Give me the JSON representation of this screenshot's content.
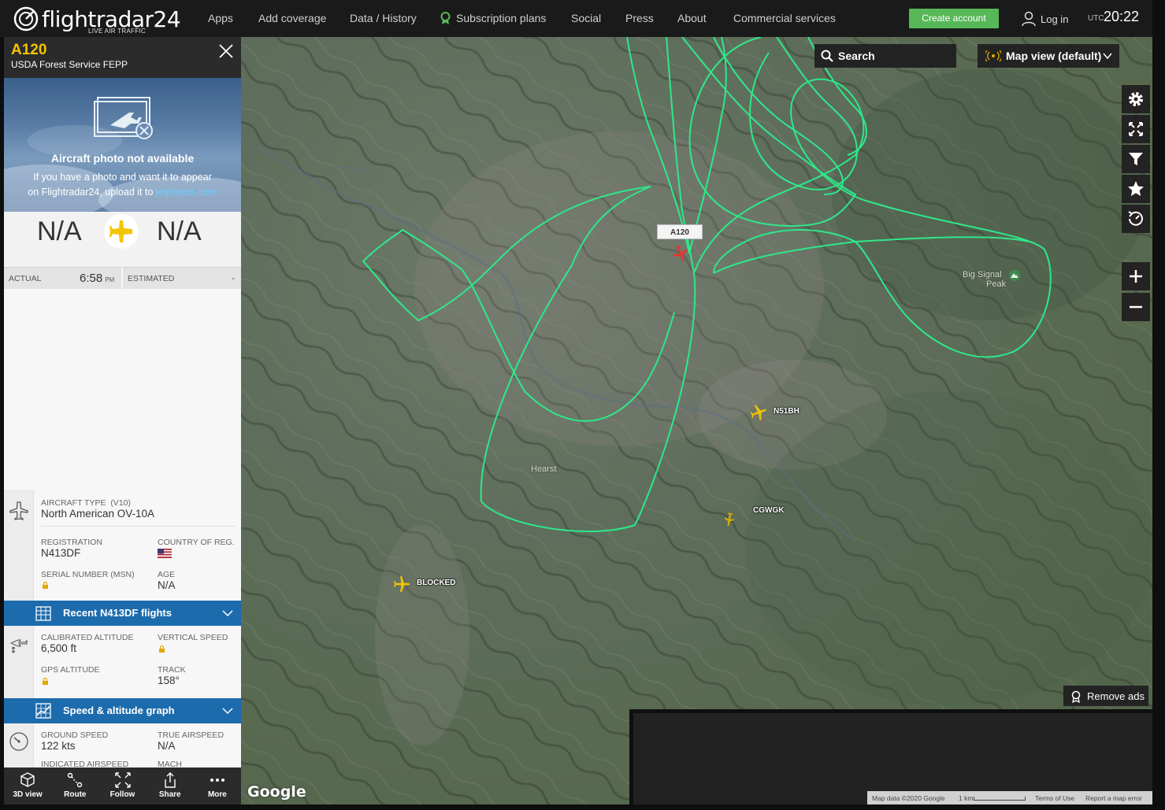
{
  "topbar": {
    "brand": "flightradar24",
    "tagline": "LIVE AIR TRAFFIC",
    "nav": [
      "Apps",
      "Add coverage",
      "Data / History",
      "Subscription plans",
      "Social",
      "Press",
      "About",
      "Commercial services"
    ],
    "create_account": "Create account",
    "login": "Log in",
    "utc_label": "UTC",
    "utc_time": "20:22"
  },
  "flight": {
    "callsign": "A120",
    "operator": "USDA Forest Service FEPP",
    "photo_title": "Aircraft photo not available",
    "photo_line1": "If you have a photo and want it to appear",
    "photo_line2": "on Flightradar24, upload it to",
    "photo_link": "jetphotos.com",
    "departure": "N/A",
    "arrival": "N/A",
    "actual_label": "ACTUAL",
    "actual_time": "6:58",
    "actual_ampm": "PM",
    "estimated_label": "ESTIMATED",
    "estimated_value": "-"
  },
  "aircraft": {
    "type_label": "AIRCRAFT TYPE",
    "type_code": "(V10)",
    "type_value": "North American OV-10A",
    "registration_label": "REGISTRATION",
    "registration_value": "N413DF",
    "country_label": "COUNTRY OF REG.",
    "serial_label": "SERIAL NUMBER (MSN)",
    "age_label": "AGE",
    "age_value": "N/A"
  },
  "recent_flights_label": "Recent N413DF flights",
  "altitude": {
    "cal_alt_label": "CALIBRATED ALTITUDE",
    "cal_alt_value": "6,500 ft",
    "vspeed_label": "VERTICAL SPEED",
    "gps_alt_label": "GPS ALTITUDE",
    "track_label": "TRACK",
    "track_value": "158°"
  },
  "graph_label": "Speed & altitude graph",
  "speed": {
    "ground_label": "GROUND SPEED",
    "ground_value": "122 kts",
    "true_label": "TRUE AIRSPEED",
    "true_value": "N/A",
    "indicated_label": "INDICATED AIRSPEED",
    "mach_label": "MACH"
  },
  "toolbar": {
    "items": [
      "3D view",
      "Route",
      "Follow",
      "Share",
      "More"
    ]
  },
  "map": {
    "search": "Search",
    "map_view": "Map view (default)",
    "aircraft_labels": {
      "selected": "A120",
      "n51bh": "N51BH",
      "cgwgk": "CGWGK",
      "blocked": "BLOCKED"
    },
    "places": {
      "peak1": "Big Signal",
      "peak2": "Peak",
      "town": "Hearst"
    },
    "remove_ads": "Remove ads",
    "google": "Google",
    "attribution": {
      "data": "Map data ©2020 Google",
      "scale": "1 km",
      "terms": "Terms of Use",
      "report": "Report a map error"
    },
    "track_color": "#2ee88a",
    "selected_color": "#e8332e",
    "plane_color": "#f5c400"
  }
}
